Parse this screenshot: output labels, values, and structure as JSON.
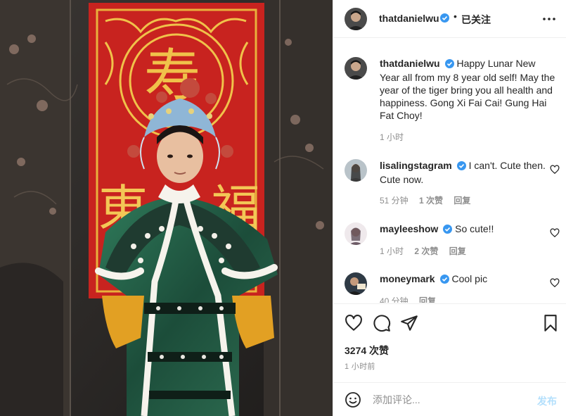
{
  "post": {
    "username": "thatdanielwu",
    "follow_status": "已关注",
    "separator": "•"
  },
  "caption": {
    "username": "thatdanielwu",
    "text": "Happy Lunar New Year all from my 8 year old self! May the year of the tiger bring you all health and happiness. Gong Xi Fai Cai! Gung Hai Fat Choy!",
    "time": "1 小时"
  },
  "comments": [
    {
      "username": "lisalingstagram",
      "text": "I can't. Cute then. Cute now.",
      "time": "51 分钟",
      "likes": "1 次赞",
      "reply": "回复"
    },
    {
      "username": "mayleeshow",
      "text": "So cute!!",
      "time": "1 小时",
      "likes": "2 次赞",
      "reply": "回复"
    },
    {
      "username": "moneymark",
      "text": "Cool pic",
      "time": "40 分钟",
      "likes": "",
      "reply": "回复"
    }
  ],
  "stats": {
    "likes": "3274 次赞",
    "time_ago": "1 小时前"
  },
  "add_comment": {
    "placeholder": "添加评论...",
    "post_label": "发布"
  },
  "colors": {
    "verified_blue": "#3897f0",
    "muted_text": "#8e8e8e",
    "post_button_disabled": "#b2dffc",
    "banner_red": "#c8231f"
  },
  "icons": {
    "more": "more-options-icon",
    "heart": "heart-icon",
    "comment": "comment-icon",
    "share": "share-icon",
    "save": "bookmark-icon",
    "emoji": "emoji-icon",
    "verified": "verified-badge-icon"
  }
}
